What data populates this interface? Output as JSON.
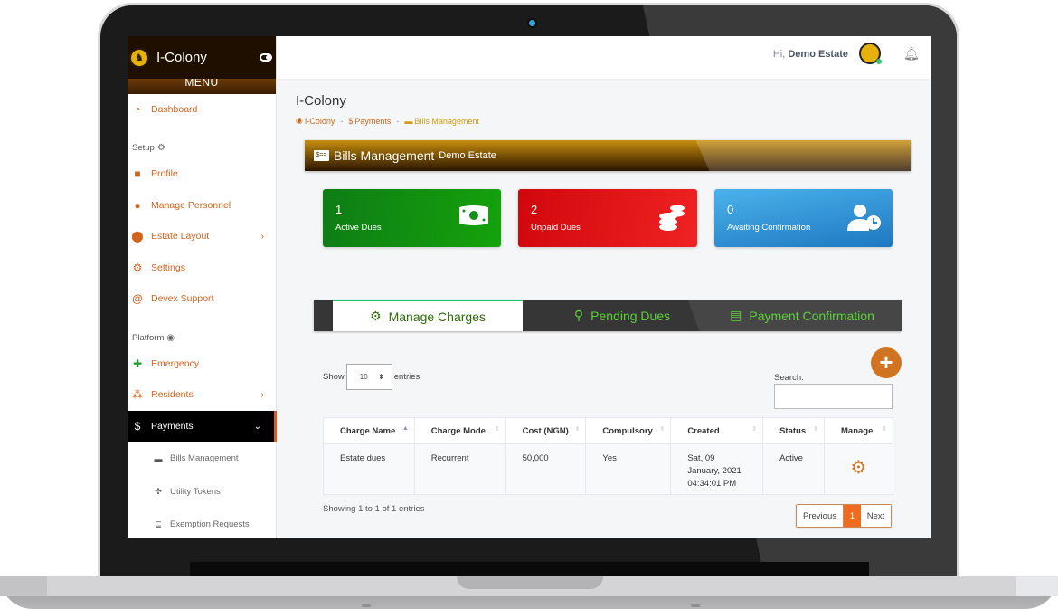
{
  "brand": {
    "name": "I-Colony",
    "menu_label": "MENU"
  },
  "sidebar": {
    "items": [
      {
        "label": "Dashboard",
        "icon": "dashboard-icon"
      },
      {
        "label": "Profile",
        "icon": "briefcase-icon"
      },
      {
        "label": "Manage Personnel",
        "icon": "user-tie-icon"
      },
      {
        "label": "Estate Layout",
        "icon": "map-marker-icon"
      },
      {
        "label": "Settings",
        "icon": "gear-icon"
      },
      {
        "label": "Devex Support",
        "icon": "at-icon"
      },
      {
        "label": "Emergency",
        "icon": "ambulance-icon"
      },
      {
        "label": "Residents",
        "icon": "users-cog-icon"
      },
      {
        "label": "Payments",
        "icon": "hand-holding-dollar-icon"
      }
    ],
    "sections": {
      "setup": "Setup",
      "platform": "Platform"
    },
    "sub_items": [
      {
        "label": "Bills Management",
        "icon": "money-bill-icon"
      },
      {
        "label": "Utility Tokens",
        "icon": "gift-icon"
      },
      {
        "label": "Exemption Requests",
        "icon": "dolly-icon"
      }
    ]
  },
  "topbar": {
    "greeting": "Hi,",
    "user_name": "Demo Estate"
  },
  "page": {
    "title": "I-Colony",
    "breadcrumb": [
      "I-Colony",
      "Payments",
      "Bills Management"
    ],
    "banner_title": "Bills Management",
    "banner_subtitle": "Demo Estate"
  },
  "stats": [
    {
      "value": "1",
      "label": "Active Dues",
      "color": "#11901a",
      "icon": "money-bill-icon"
    },
    {
      "value": "2",
      "label": "Unpaid Dues",
      "color": "#e01318",
      "icon": "coins-icon"
    },
    {
      "value": "0",
      "label": "Awaiting Confirmation",
      "color": "#3297dc",
      "icon": "user-clock-icon"
    }
  ],
  "tabs": [
    {
      "label": "Manage Charges",
      "icon": "cogs-icon",
      "active": true
    },
    {
      "label": "Pending Dues",
      "icon": "search-dollar-icon",
      "active": false
    },
    {
      "label": "Payment Confirmation",
      "icon": "credit-card-icon",
      "active": false
    }
  ],
  "table_controls": {
    "show_label": "Show",
    "entries_label": "entries",
    "page_length": "10",
    "search_label": "Search:",
    "search_value": ""
  },
  "table": {
    "columns": [
      "Charge Name",
      "Charge Mode",
      "Cost (NGN)",
      "Compulsory",
      "Created",
      "Status",
      "Manage"
    ],
    "rows": [
      {
        "charge_name": "Estate dues",
        "charge_mode": "Recurrent",
        "cost": "50,000",
        "compulsory": "Yes",
        "created_1": "Sat, 09",
        "created_2": "January, 2021",
        "created_3": "04:34:01 PM",
        "status": "Active"
      }
    ]
  },
  "pagination": {
    "info": "Showing 1 to 1 of 1 entries",
    "previous": "Previous",
    "current": "1",
    "next": "Next"
  },
  "colors": {
    "accent": "#d2641f",
    "tab_text": "#5bd13a",
    "pager_active": "#ee6b1f"
  }
}
